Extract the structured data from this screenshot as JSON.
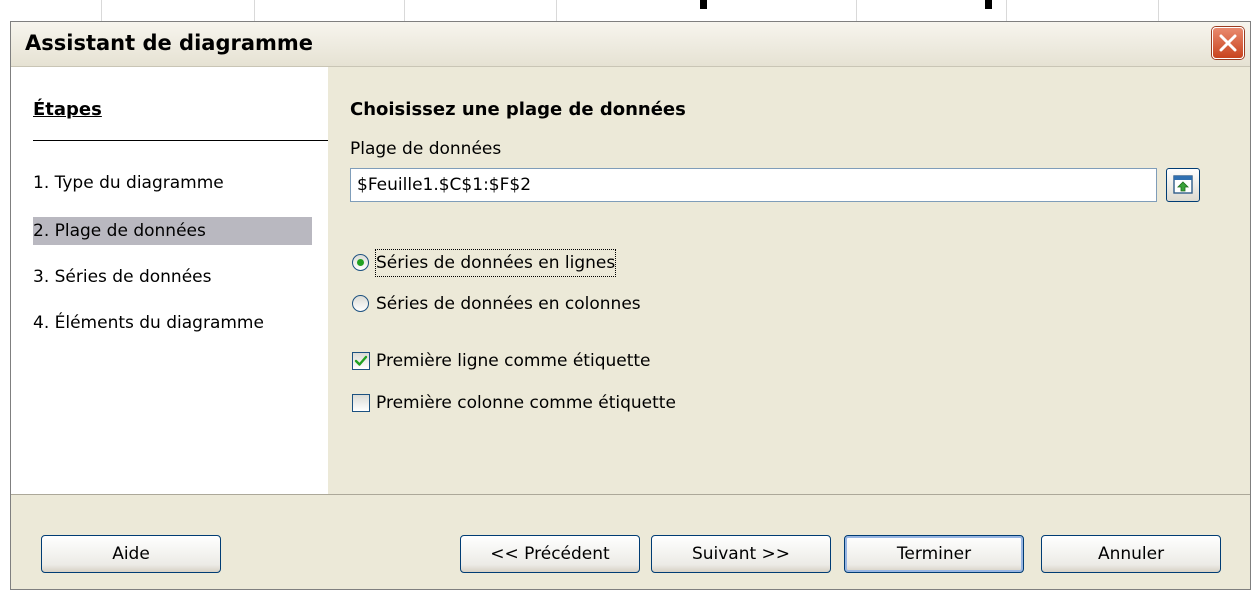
{
  "dialog": {
    "title": "Assistant de diagramme"
  },
  "steps": {
    "heading": "Étapes",
    "items": [
      {
        "label": "1. Type du diagramme",
        "selected": false
      },
      {
        "label": "2. Plage de données",
        "selected": true
      },
      {
        "label": "3. Séries de données",
        "selected": false
      },
      {
        "label": "4. Éléments du diagramme",
        "selected": false
      }
    ]
  },
  "main": {
    "section_title": "Choisissez une plage de données",
    "range_label": "Plage de données",
    "range_value": "$Feuille1.$C$1:$F$2",
    "options": {
      "rows_label": "Séries de données en lignes",
      "columns_label": "Séries de données en colonnes",
      "selected": "rows"
    },
    "checkboxes": {
      "first_row_label": "Première ligne comme étiquette",
      "first_row_checked": true,
      "first_col_label": "Première colonne comme étiquette",
      "first_col_checked": false
    }
  },
  "buttons": {
    "help": "Aide",
    "previous": "<< Précédent",
    "next": "Suivant >>",
    "finish": "Terminer",
    "cancel": "Annuler"
  },
  "icons": {
    "close": "close-icon",
    "shrink": "shrink-icon"
  },
  "colors": {
    "dialog_bg": "#ece9d8",
    "selection": "#b9b8c0",
    "button_border": "#003c74",
    "close_red": "#c8431e",
    "radio_green": "#21a121"
  }
}
